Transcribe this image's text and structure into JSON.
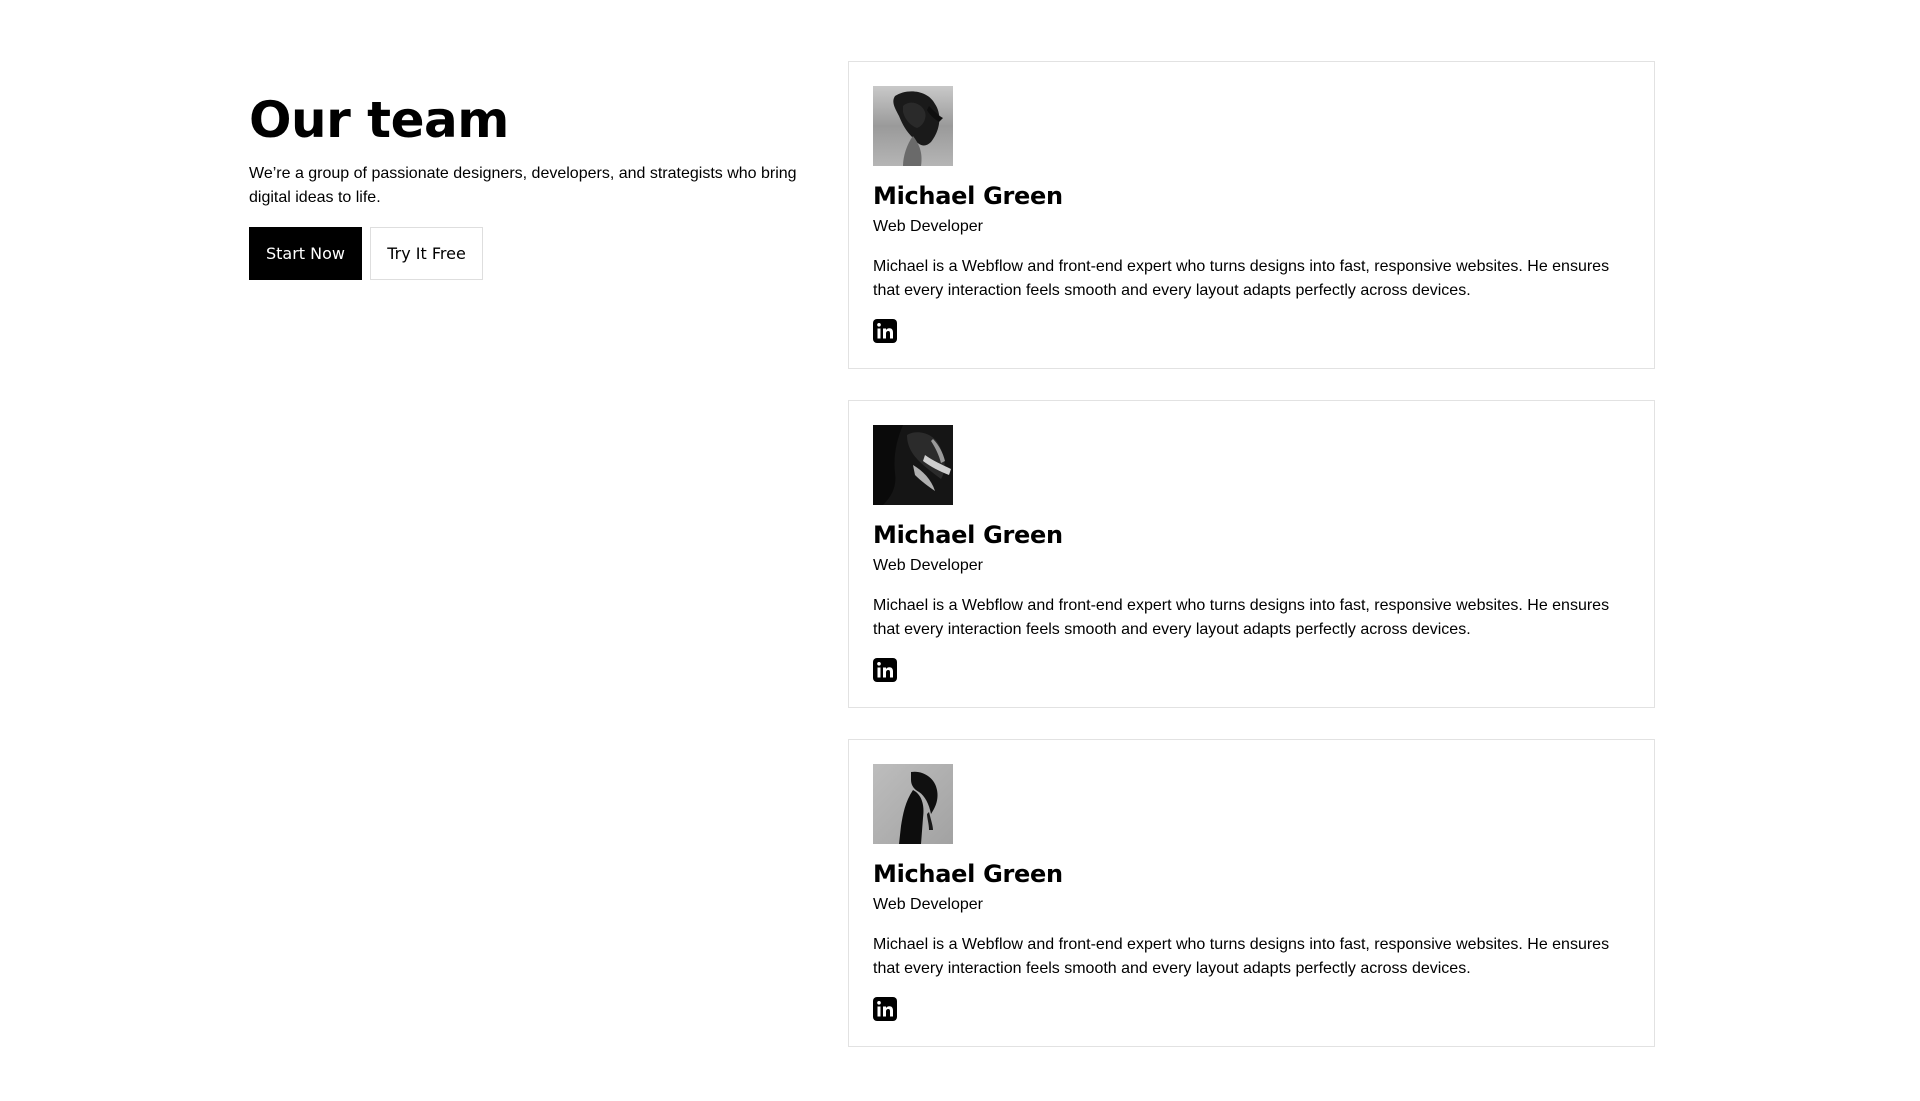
{
  "header": {
    "title": "Our team",
    "description": "We’re a group of passionate designers, developers, and strategists who bring digital ideas to life.",
    "primary_button": "Start Now",
    "secondary_button": "Try It Free"
  },
  "team": [
    {
      "name": "Michael Green",
      "role": "Web Developer",
      "bio": "Michael is a Webflow and front-end expert who turns designs into fast, responsive websites. He ensures that every interaction feels smooth and every layout adapts perfectly across devices.",
      "social_icon": "linkedin-icon"
    },
    {
      "name": "Michael Green",
      "role": "Web Developer",
      "bio": "Michael is a Webflow and front-end expert who turns designs into fast, responsive websites. He ensures that every interaction feels smooth and every layout adapts perfectly across devices.",
      "social_icon": "linkedin-icon"
    },
    {
      "name": "Michael Green",
      "role": "Web Developer",
      "bio": "Michael is a Webflow and front-end expert who turns designs into fast, responsive websites. He ensures that every interaction feels smooth and every layout adapts perfectly across devices.",
      "social_icon": "linkedin-icon"
    }
  ],
  "colors": {
    "text": "#000000",
    "background": "#ffffff",
    "border": "#e2e2e2",
    "primary_button": "#000000"
  }
}
